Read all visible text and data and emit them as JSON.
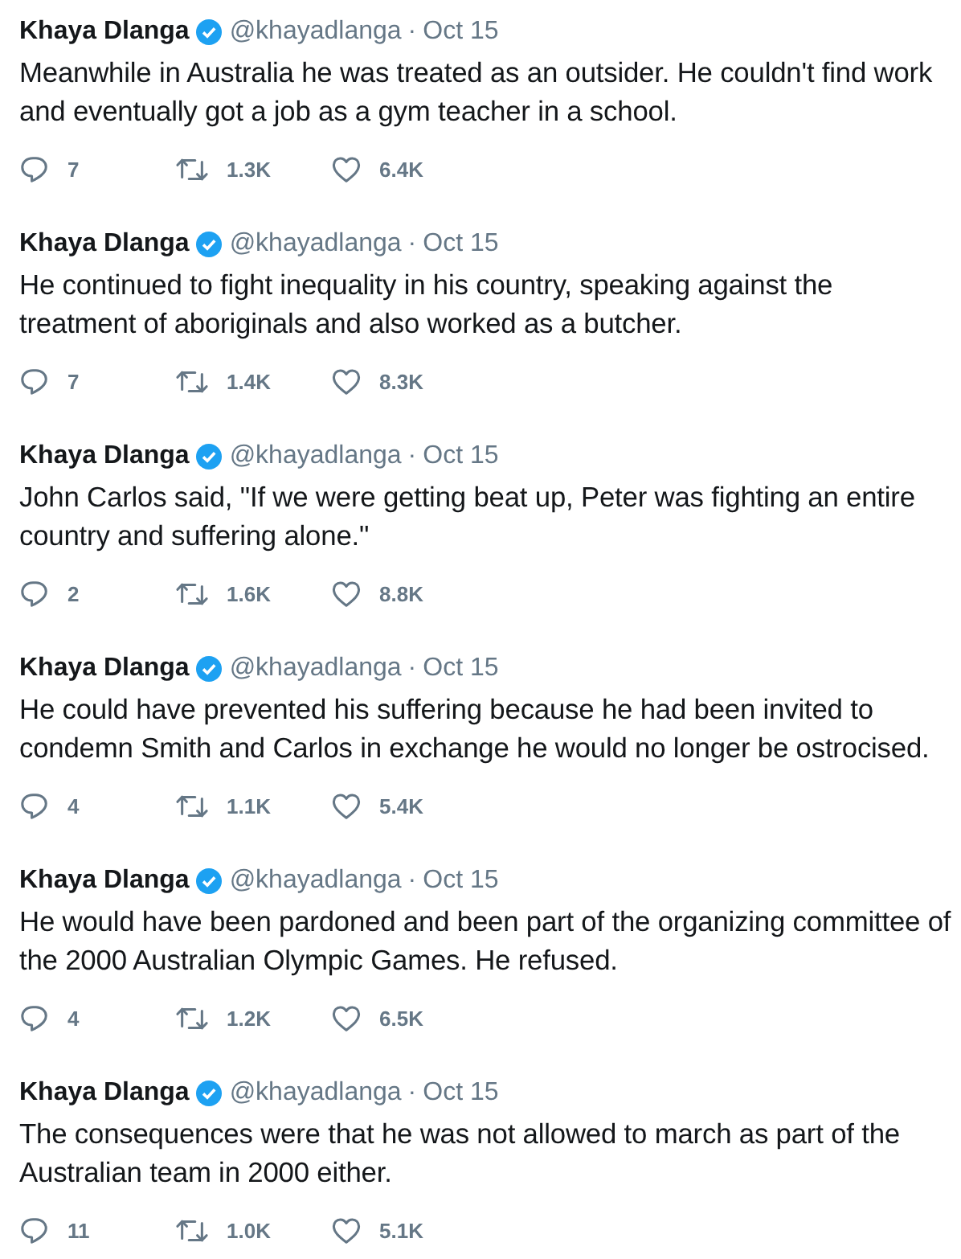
{
  "separator": "·",
  "tweets": [
    {
      "name": "Khaya Dlanga",
      "verified": true,
      "handle": "@khayadlanga",
      "date": "Oct 15",
      "lines": [
        "Meanwhile in Australia he was treated as an outsider. He couldn't find work",
        "and eventually got a job as a gym teacher in a school."
      ],
      "replies": "7",
      "retweets": "1.3K",
      "likes": "6.4K"
    },
    {
      "name": "Khaya Dlanga",
      "verified": true,
      "handle": "@khayadlanga",
      "date": "Oct 15",
      "lines": [
        "He continued to fight inequality in his country, speaking against the",
        "treatment of aboriginals and also worked as a butcher."
      ],
      "replies": "7",
      "retweets": "1.4K",
      "likes": "8.3K"
    },
    {
      "name": "Khaya Dlanga",
      "verified": true,
      "handle": "@khayadlanga",
      "date": "Oct 15",
      "lines": [
        "John Carlos said, \"If we were getting beat up, Peter was fighting an entire",
        "country and suffering alone.\""
      ],
      "replies": "2",
      "retweets": "1.6K",
      "likes": "8.8K"
    },
    {
      "name": "Khaya Dlanga",
      "verified": true,
      "handle": "@khayadlanga",
      "date": "Oct 15",
      "lines": [
        "He could have prevented his suffering because he had been invited to",
        "condemn Smith and Carlos in exchange he would no longer be ostrocised."
      ],
      "replies": "4",
      "retweets": "1.1K",
      "likes": "5.4K"
    },
    {
      "name": "Khaya Dlanga",
      "verified": true,
      "handle": "@khayadlanga",
      "date": "Oct 15",
      "lines": [
        "He would have been pardoned and been part of the organizing committee of",
        "the 2000 Australian Olympic Games. He refused."
      ],
      "replies": "4",
      "retweets": "1.2K",
      "likes": "6.5K"
    },
    {
      "name": "Khaya Dlanga",
      "verified": true,
      "handle": "@khayadlanga",
      "date": "Oct 15",
      "lines": [
        "The consequences were that he was not allowed to march as part of the",
        "Australian team in 2000 either."
      ],
      "replies": "11",
      "retweets": "1.0K",
      "likes": "5.1K"
    }
  ]
}
